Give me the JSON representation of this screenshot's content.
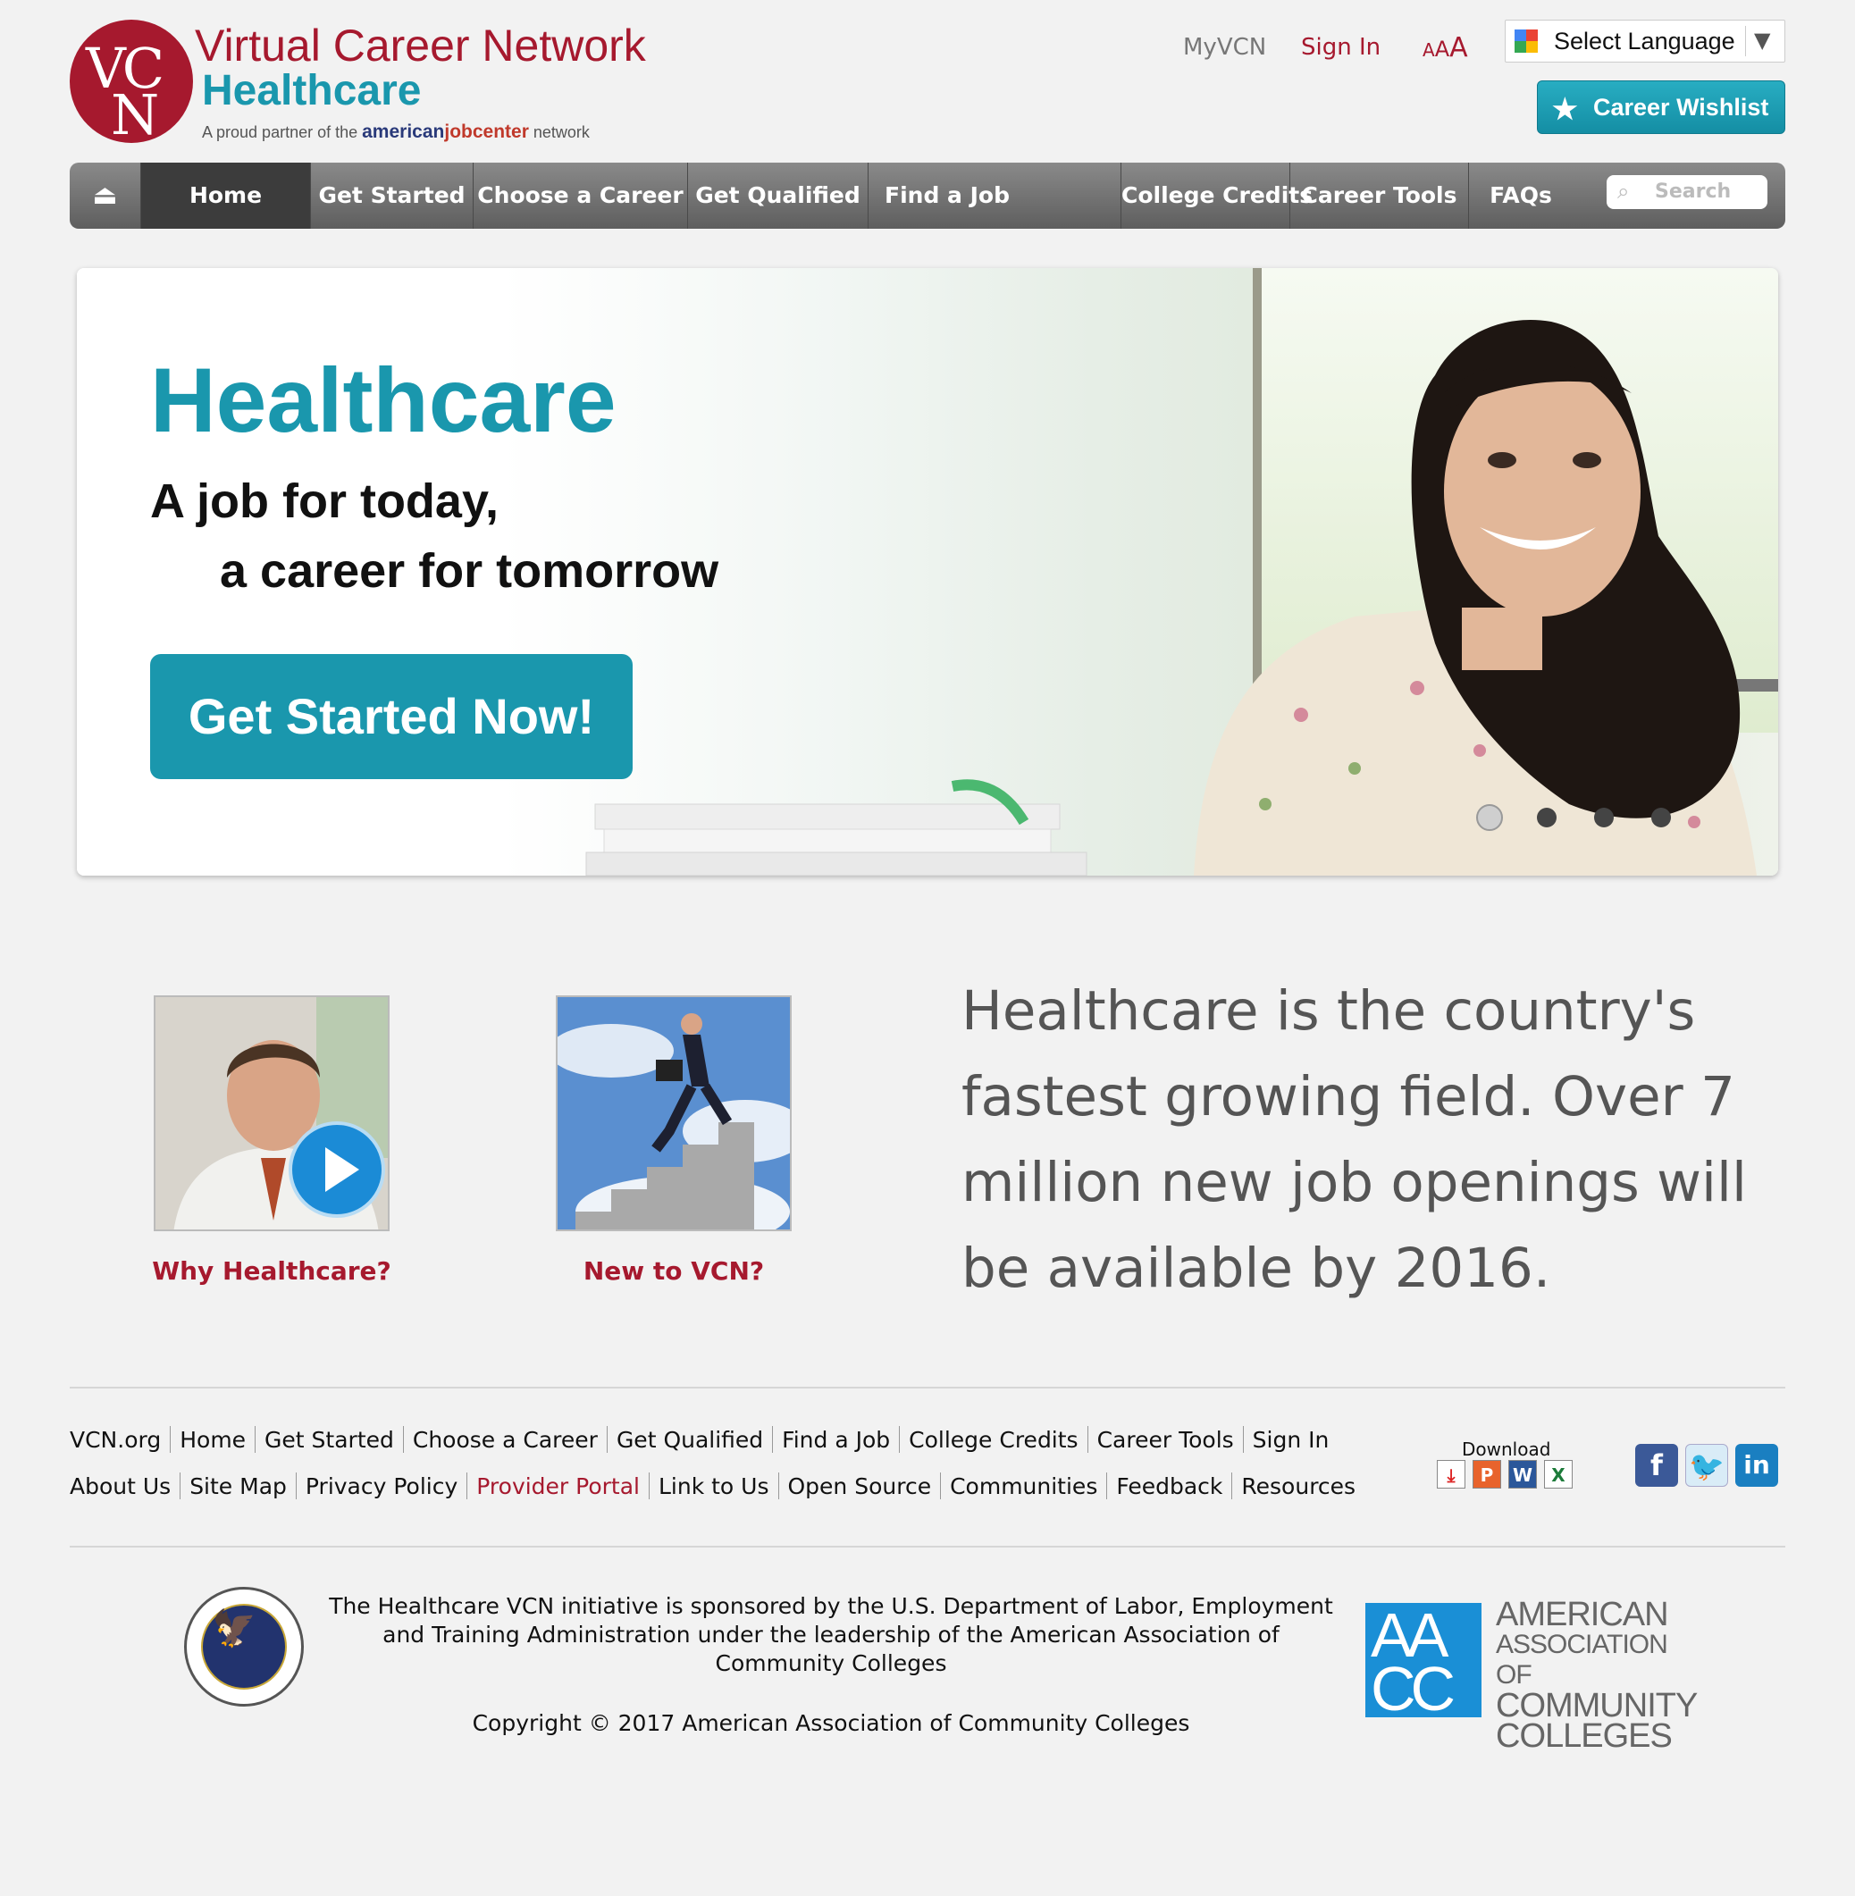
{
  "logo": {
    "mark_top": "VC",
    "mark_bottom": "N",
    "title": "Virtual Career Network",
    "subtitle": "Healthcare",
    "partner_prefix": "A proud partner of the ",
    "partner_american": "american",
    "partner_job": "jobcenter",
    "partner_suffix": " network"
  },
  "header": {
    "myvcn": "MyVCN",
    "sign_in": "Sign In",
    "text_size_small": "A",
    "text_size_medium": "A",
    "text_size_large": "A",
    "language_select": "Select Language",
    "career_wishlist": "Career Wishlist"
  },
  "nav": {
    "items": [
      "Home",
      "Get Started",
      "Choose a Career",
      "Get Qualified",
      "Find a Job",
      "College Credits",
      "Career Tools",
      "FAQs"
    ],
    "search_placeholder": "Search"
  },
  "hero": {
    "title": "Healthcare",
    "line1": "A job for today,",
    "line2": "a career for tomorrow",
    "cta": "Get Started Now!",
    "slides": 4,
    "active_slide": 1
  },
  "features": {
    "why": "Why Healthcare?",
    "new": "New to VCN?",
    "stat": "Healthcare is the country's fastest growing field. Over 7 million new job openings will be available by 2016."
  },
  "footer": {
    "row1": [
      "VCN.org",
      "Home",
      "Get Started",
      "Choose a Career",
      "Get Qualified",
      "Find a Job",
      "College Credits",
      "Career Tools",
      "Sign In"
    ],
    "row2": [
      "About Us",
      "Site Map",
      "Privacy Policy",
      "Provider Portal",
      "Link to Us",
      "Open Source",
      "Communities",
      "Feedback",
      "Resources"
    ],
    "download": "Download",
    "download_icons": [
      "pdf-icon",
      "powerpoint-icon",
      "word-icon",
      "excel-icon"
    ],
    "social": [
      "facebook-icon",
      "twitter-icon",
      "linkedin-icon"
    ],
    "sponsor": "The Healthcare VCN initiative is sponsored by the U.S. Department of Labor, Employment and Training Administration under the leadership of the American Association of Community Colleges",
    "copyright": "Copyright © 2017 American Association of Community Colleges"
  },
  "aacc": {
    "mark_top": "AA",
    "mark_bottom": "CC",
    "line1": "AMERICAN",
    "line2": "ASSOCIATION OF",
    "line3": "COMMUNITY",
    "line4": "COLLEGES"
  },
  "colors": {
    "brand_red": "#a6192e",
    "brand_teal": "#1a97ad",
    "page_bg": "#f2f2f2"
  }
}
